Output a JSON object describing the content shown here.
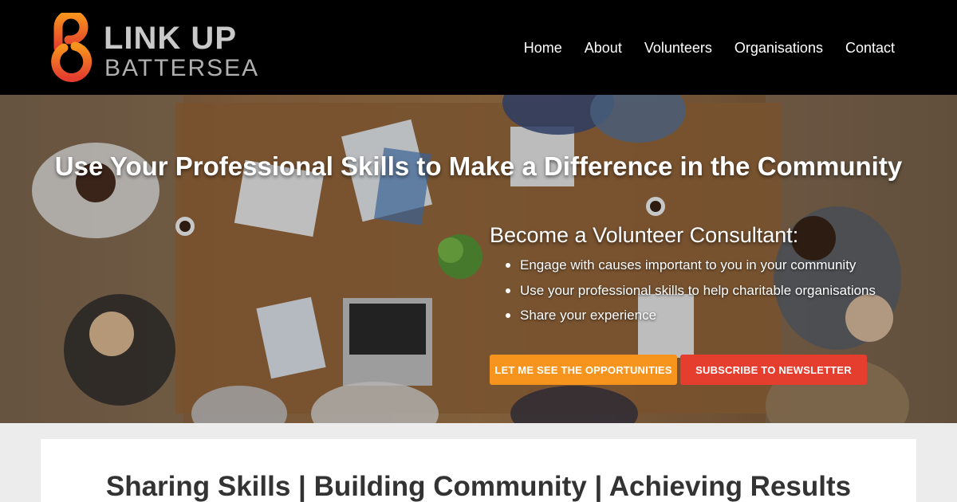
{
  "brand": {
    "line1": "LINK UP",
    "line2": "BATTERSEA",
    "logo_icon": "b-link-logo-icon",
    "gradient_top": "#f7941d",
    "gradient_bottom": "#e53e2e"
  },
  "nav": {
    "items": [
      {
        "label": "Home"
      },
      {
        "label": "About"
      },
      {
        "label": "Volunteers"
      },
      {
        "label": "Organisations"
      },
      {
        "label": "Contact"
      }
    ]
  },
  "hero": {
    "title": "Use Your Professional Skills to Make a Difference in the Community",
    "volunteer_heading": "Become a Volunteer Consultant:",
    "bullets": [
      "Engage with causes important to you in your community",
      "Use your professional skills to help charitable organisations",
      "Share your experience"
    ],
    "primary_button": "LET ME SEE THE OPPORTUNITIES",
    "secondary_button": "SUBSCRIBE TO NEWSLETTER",
    "primary_color": "#f7941d",
    "secondary_color": "#e53e2e"
  },
  "tagline": "Sharing Skills | Building Community | Achieving Results"
}
